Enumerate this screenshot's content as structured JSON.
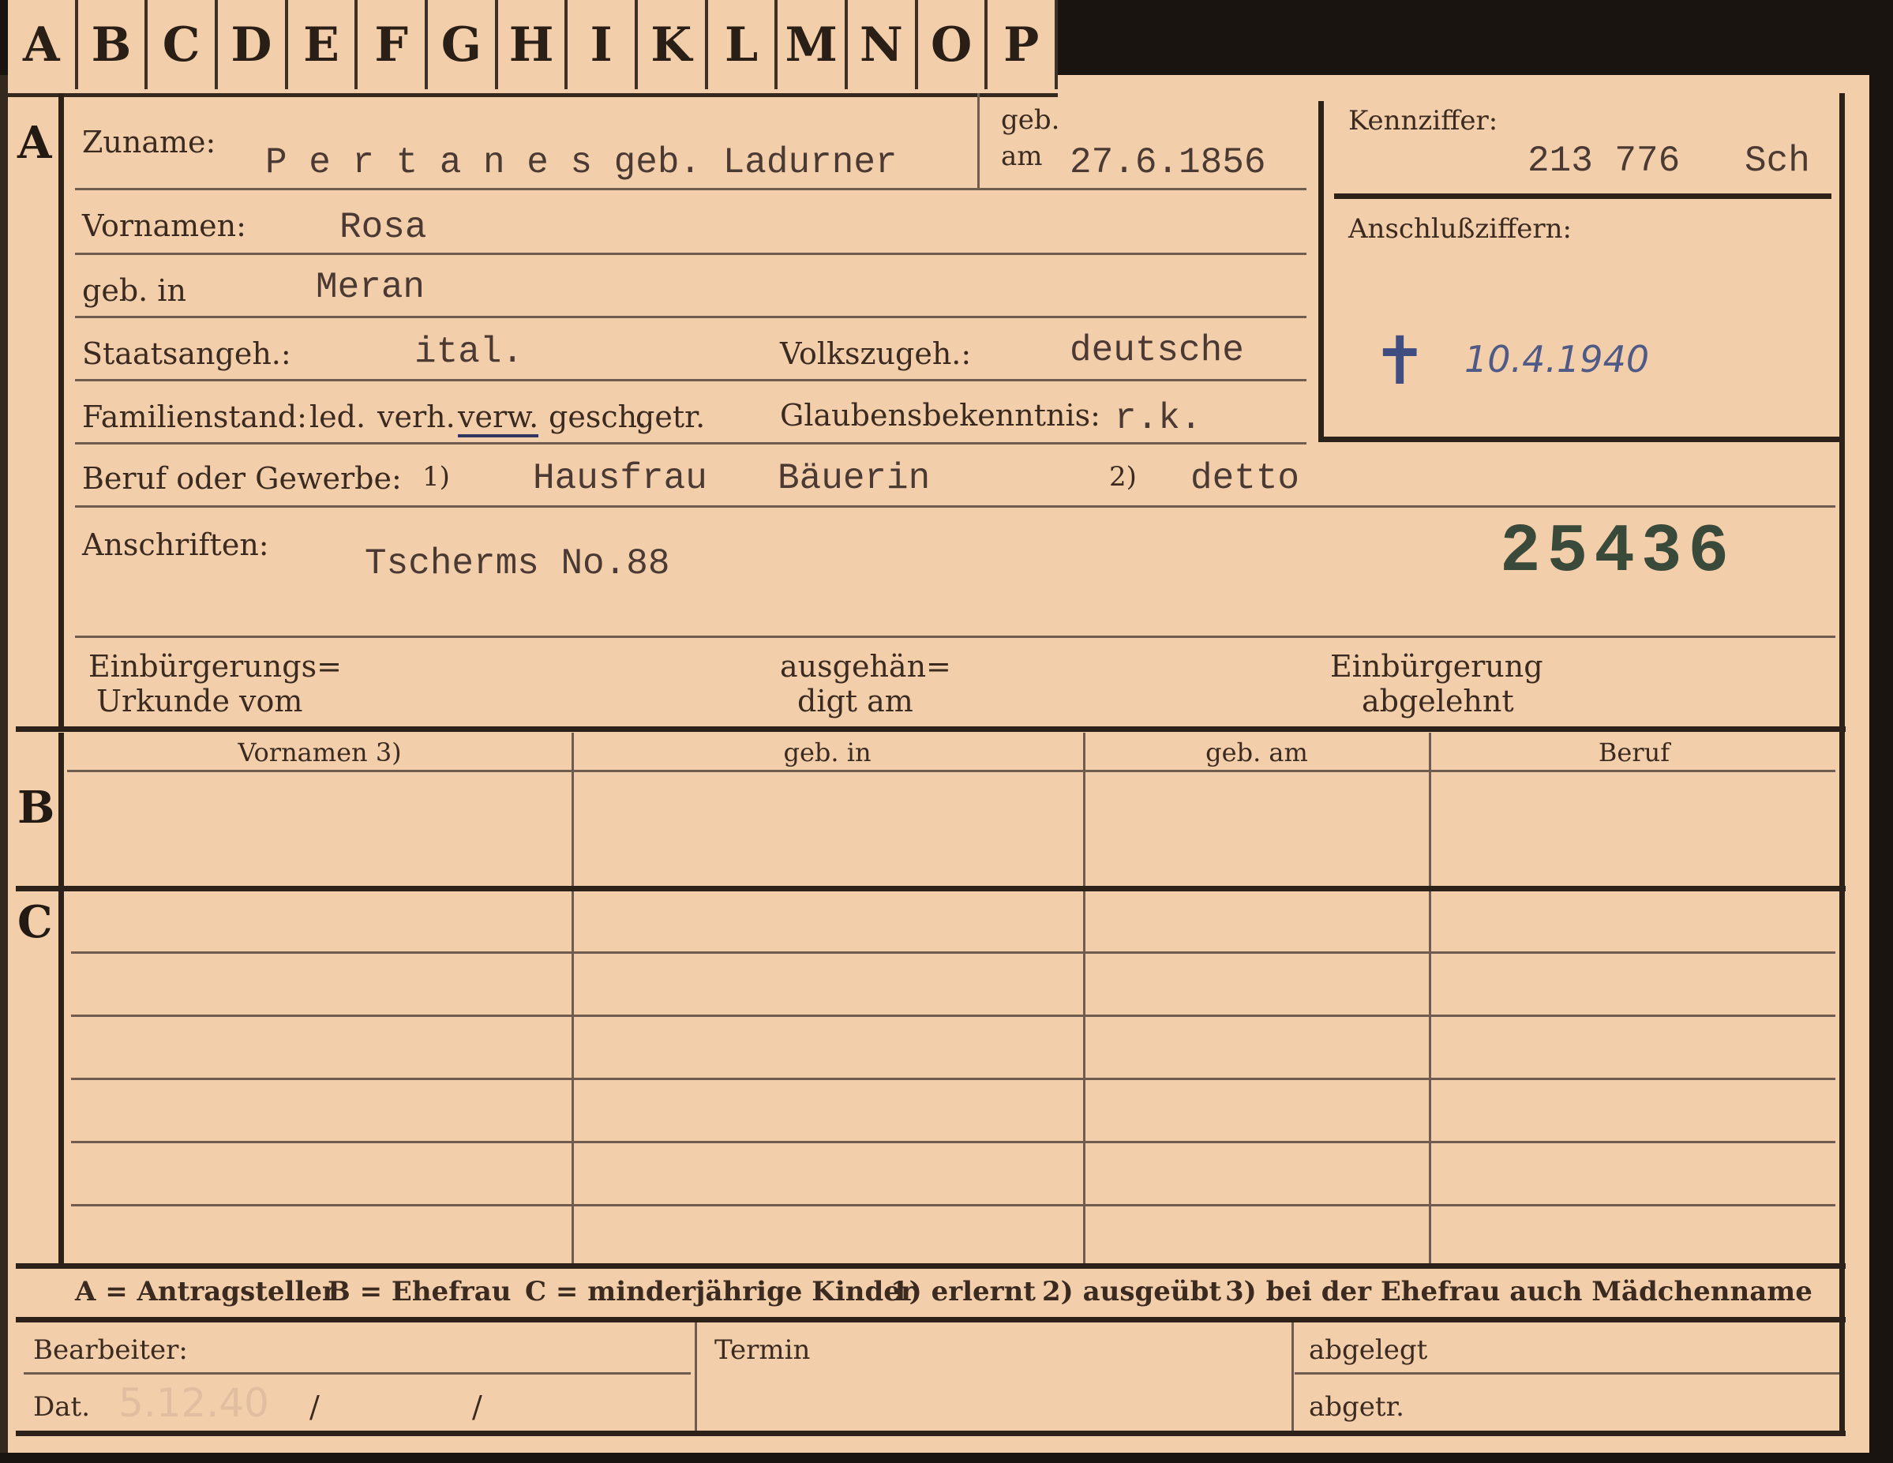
{
  "tabs": [
    "A",
    "B",
    "C",
    "D",
    "E",
    "F",
    "G",
    "H",
    "I",
    "K",
    "L",
    "M",
    "N",
    "O",
    "P"
  ],
  "sections": {
    "a": "A",
    "b": "B",
    "c": "C"
  },
  "labels": {
    "zuname": "Zuname:",
    "geb_am_1": "geb.",
    "geb_am_2": "am",
    "vornamen": "Vornamen:",
    "geb_in": "geb. in",
    "staatsangeh": "Staatsangeh.:",
    "volkszugeh": "Volkszugeh.:",
    "familienstand": "Familienstand:",
    "fam_options": [
      "led.",
      "verh.",
      "verw.",
      "gesch.",
      "getr."
    ],
    "glaubensbekenntnis": "Glaubensbekenntnis:",
    "beruf": "Beruf oder Gewerbe:",
    "beruf_note1": "1)",
    "beruf_note2": "2)",
    "anschriften": "Anschriften:",
    "einbuergerungs_1": "Einbürgerungs=",
    "einbuergerungs_2": "Urkunde vom",
    "ausgehaendigt_1": "ausgehän=",
    "ausgehaendigt_2": "digt am",
    "einbuergerung_abg_1": "Einbürgerung",
    "einbuergerung_abg_2": "abgelehnt",
    "kennziffer": "Kennziffer:",
    "anschlussziffern": "Anschlußziffern:"
  },
  "values": {
    "zuname": "P e r t a n e s geb. Ladurner",
    "geb_am": "27.6.1856",
    "vornamen": "Rosa",
    "geb_in": "Meran",
    "staatsangeh": "ital.",
    "volkszugeh": "deutsche",
    "glaubensbekenntnis": "r.k.",
    "beruf_erlernt": "Hausfrau",
    "beruf_middle": "Bäuerin",
    "beruf_ausgeuebt": "detto",
    "anschrift": "Tscherms No.88",
    "stamp_number": "25436",
    "kennziffer": "213 776",
    "kennziffer_suffix": "Sch",
    "death_date": "10.4.1940",
    "death_mark": "✝",
    "bearbeiter_dat": "5.12.40"
  },
  "table": {
    "headers": [
      "Vornamen 3)",
      "geb. in",
      "geb. am",
      "Beruf"
    ]
  },
  "legend": {
    "a": "A = Antragsteller",
    "b": "B = Ehefrau",
    "c": "C = minderjährige Kinder",
    "n1": "1) erlernt",
    "n2": "2) ausgeübt",
    "n3": "3) bei der Ehefrau auch Mädchenname"
  },
  "footer": {
    "bearbeiter": "Bearbeiter:",
    "dat": "Dat.",
    "slash": "/",
    "termin": "Termin",
    "abgelegt": "abgelegt",
    "abgetr": "abgetr."
  },
  "colors": {
    "card": "#f3ceaa",
    "ink": "#2d2118",
    "handwriting": "#4f5a86"
  }
}
